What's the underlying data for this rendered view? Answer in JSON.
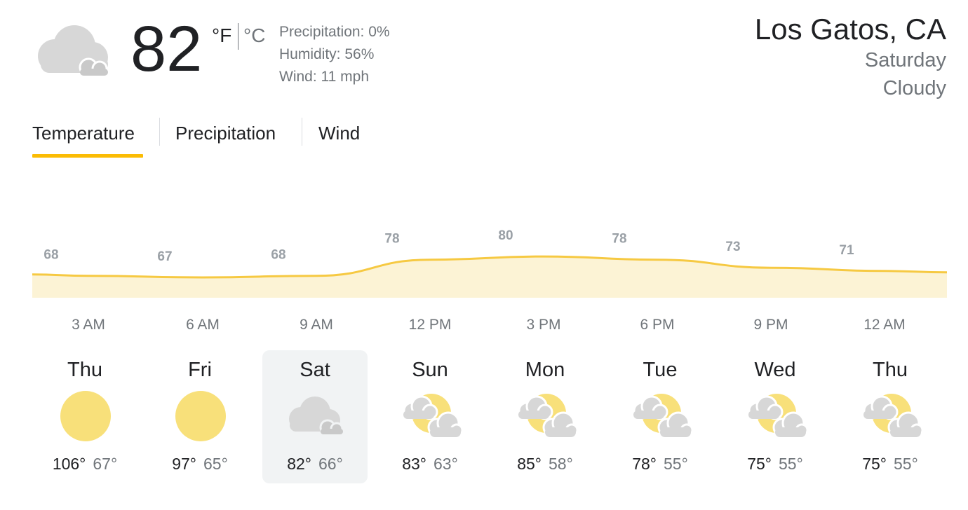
{
  "current": {
    "temperature": "82",
    "unit_f": "°F",
    "unit_c": "°C",
    "condition_icon": "cloudy-icon",
    "precipitation": "Precipitation: 0%",
    "humidity": "Humidity: 56%",
    "wind": "Wind: 11 mph"
  },
  "location": {
    "name": "Los Gatos, CA",
    "day": "Saturday",
    "condition": "Cloudy"
  },
  "tabs": [
    {
      "label": "Temperature",
      "active": true
    },
    {
      "label": "Precipitation",
      "active": false
    },
    {
      "label": "Wind",
      "active": false
    }
  ],
  "colors": {
    "accent": "#fbbc04",
    "line": "#f6c942",
    "fill": "#fcf3d5",
    "sun": "#f8e07a",
    "cloud": "#d7d7d7"
  },
  "chart_data": {
    "type": "area",
    "data_labels": [
      "68",
      "67",
      "68",
      "78",
      "80",
      "78",
      "73",
      "71"
    ],
    "values": [
      68,
      67,
      68,
      78,
      80,
      78,
      73,
      71
    ],
    "tick_labels": [
      "3 AM",
      "6 AM",
      "9 AM",
      "12 PM",
      "3 PM",
      "6 PM",
      "9 PM",
      "12 AM"
    ]
  },
  "forecast": [
    {
      "day": "Thu",
      "high": "106°",
      "low": "67°",
      "icon": "sunny-icon",
      "selected": false
    },
    {
      "day": "Fri",
      "high": "97°",
      "low": "65°",
      "icon": "sunny-icon",
      "selected": false
    },
    {
      "day": "Sat",
      "high": "82°",
      "low": "66°",
      "icon": "cloudy-icon",
      "selected": true
    },
    {
      "day": "Sun",
      "high": "83°",
      "low": "63°",
      "icon": "partly-cloudy-icon",
      "selected": false
    },
    {
      "day": "Mon",
      "high": "85°",
      "low": "58°",
      "icon": "partly-cloudy-icon",
      "selected": false
    },
    {
      "day": "Tue",
      "high": "78°",
      "low": "55°",
      "icon": "partly-cloudy-icon",
      "selected": false
    },
    {
      "day": "Wed",
      "high": "75°",
      "low": "55°",
      "icon": "partly-cloudy-icon",
      "selected": false
    },
    {
      "day": "Thu",
      "high": "75°",
      "low": "55°",
      "icon": "partly-cloudy-icon",
      "selected": false
    }
  ]
}
